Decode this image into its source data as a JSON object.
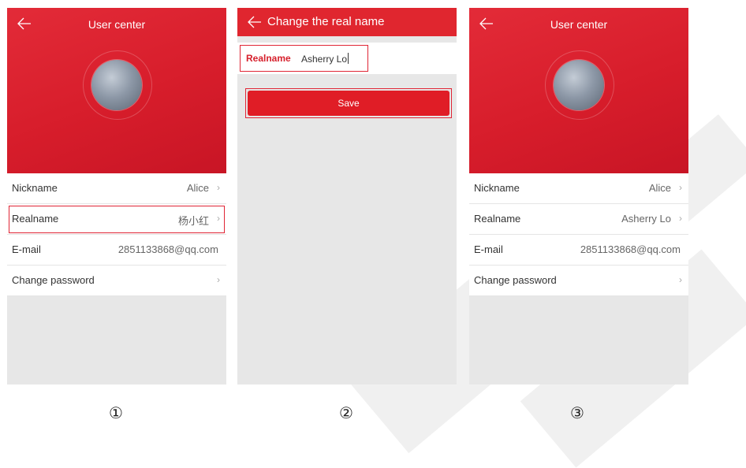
{
  "screen1": {
    "title": "User center",
    "rows": [
      {
        "label": "Nickname",
        "value": "Alice",
        "chevron": "›"
      },
      {
        "label": "Realname",
        "value": "杨小红",
        "chevron": "›"
      },
      {
        "label": "E-mail",
        "value": "2851133868@qq.com"
      },
      {
        "label": "Change password",
        "value": "",
        "chevron": "›"
      }
    ]
  },
  "screen2": {
    "title": "Change the real name",
    "field_label": "Realname",
    "field_value": "Asherry Lo",
    "save_label": "Save"
  },
  "screen3": {
    "title": "User center",
    "rows": [
      {
        "label": "Nickname",
        "value": "Alice",
        "chevron": "›"
      },
      {
        "label": "Realname",
        "value": "Asherry Lo",
        "chevron": "›"
      },
      {
        "label": "E-mail",
        "value": "2851133868@qq.com"
      },
      {
        "label": "Change password",
        "value": "",
        "chevron": "›"
      }
    ]
  },
  "steps": [
    "①",
    "②",
    "③"
  ],
  "colors": {
    "accent": "#e0262f",
    "highlight": "#e02535",
    "background": "#e7e7e7"
  }
}
